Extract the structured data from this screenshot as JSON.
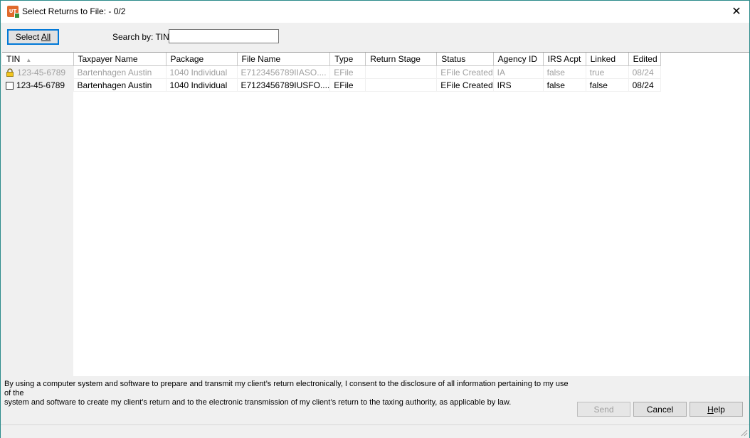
{
  "window": {
    "title": "Select Returns to File: - 0/2",
    "app_icon_text": "UT"
  },
  "toolbar": {
    "select_all_label": "Select All",
    "search_label": "Search by: TIN",
    "search_value": ""
  },
  "grid": {
    "columns": [
      "TIN",
      "Taxpayer Name",
      "Package",
      "File Name",
      "Type",
      "Return Stage",
      "Status",
      "Agency ID",
      "IRS Acpt",
      "Linked",
      "Edited"
    ],
    "rows": [
      {
        "state": "locked",
        "icon": "lock-icon",
        "tin": "123-45-6789",
        "taxpayer_name": "Bartenhagen Austin",
        "package": "1040 Individual",
        "file_name": "E7123456789IIASO....",
        "type": "EFile",
        "return_stage": "",
        "status": "EFile Created",
        "agency_id": "IA",
        "irs_acpt": "false",
        "linked": "true",
        "edited": "08/24"
      },
      {
        "state": "unchecked",
        "icon": "checkbox-icon",
        "tin": "123-45-6789",
        "taxpayer_name": "Bartenhagen Austin",
        "package": "1040 Individual",
        "file_name": "E7123456789IUSFO....",
        "type": "EFile",
        "return_stage": "",
        "status": "EFile Created",
        "agency_id": "IRS",
        "irs_acpt": "false",
        "linked": "false",
        "edited": "08/24"
      }
    ]
  },
  "consent_text_line1": "By using a computer system and software to prepare and transmit my client’s return electronically, I consent to the disclosure of all information pertaining to my use of the",
  "consent_text_line2": "system and software to create my client’s return and to the electronic transmission of my client’s return to the taxing authority, as applicable by law.",
  "buttons": {
    "send_label": "Send",
    "cancel_label": "Cancel",
    "help_label": "Help"
  }
}
